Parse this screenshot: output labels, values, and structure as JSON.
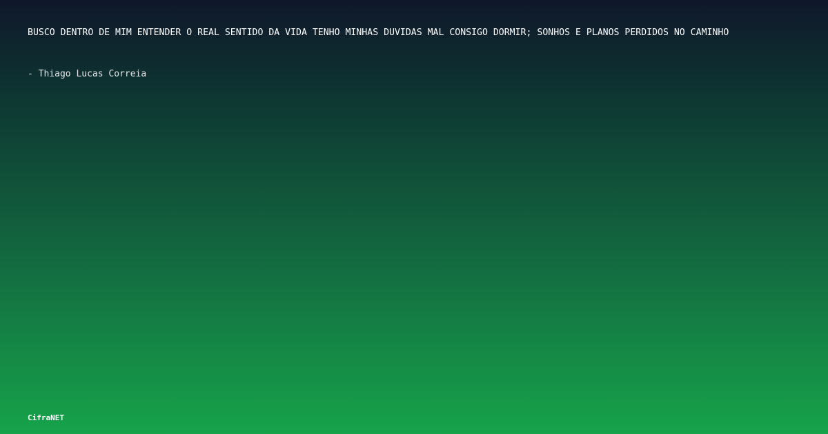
{
  "quote": {
    "text": "BUSCO DENTRO DE MIM ENTENDER O REAL SENTIDO DA VIDA TENHO MINHAS DUVIDAS MAL CONSIGO DORMIR; SONHOS E PLANOS PERDIDOS NO CAMINHO"
  },
  "author": {
    "text": "- Thiago Lucas Correia"
  },
  "brand": {
    "name": "CifraNET"
  },
  "colors": {
    "background_top": "#0f172a",
    "background_bottom": "#16a34a",
    "text": "#ffffff"
  }
}
